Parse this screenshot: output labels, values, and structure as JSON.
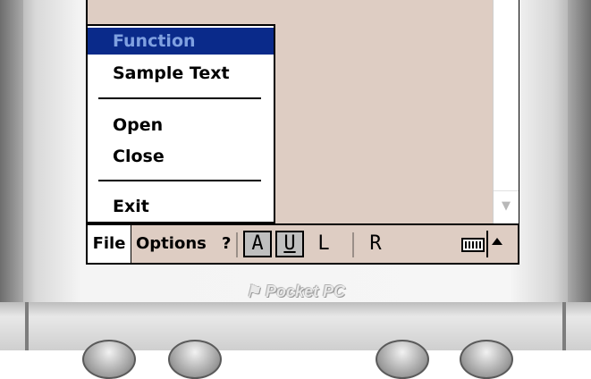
{
  "menu": {
    "items": [
      {
        "label": "Function",
        "selected": true
      },
      {
        "label": "Sample Text",
        "selected": false
      },
      {
        "label": "Open",
        "selected": false
      },
      {
        "label": "Close",
        "selected": false
      },
      {
        "label": "Exit",
        "selected": false
      }
    ]
  },
  "command_bar": {
    "file_label": "File",
    "options_label": "Options",
    "help_label": "?",
    "align_buttons": [
      {
        "label": "A",
        "pressed": true
      },
      {
        "label": "U",
        "pressed": true
      },
      {
        "label": "L",
        "pressed": false
      },
      {
        "label": "R",
        "pressed": false
      }
    ]
  },
  "device": {
    "logo_text": "Pocket PC",
    "logo_icon": "windows-flag-icon"
  },
  "colors": {
    "selection": "#0a2a8a",
    "content_background": "#decdc3"
  }
}
